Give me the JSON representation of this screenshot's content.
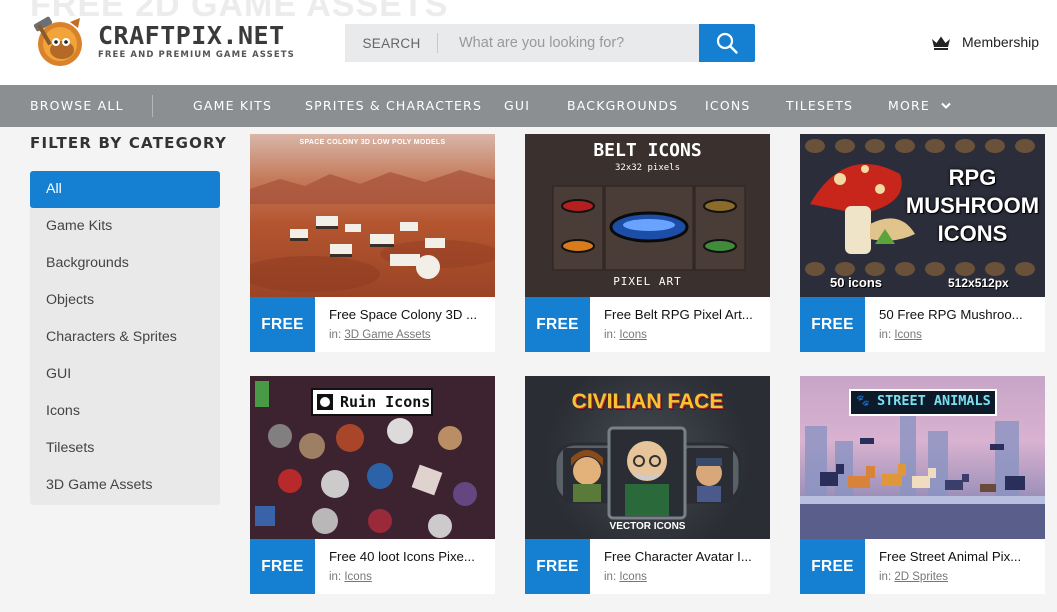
{
  "header": {
    "ghost_title": "FREE 2D GAME ASSETS",
    "logo_name": "CRAFTPIX.NET",
    "logo_tagline": "FREE AND PREMIUM GAME ASSETS",
    "search_label": "SEARCH",
    "search_placeholder": "What are you looking for?",
    "membership_label": "Membership"
  },
  "nav": {
    "browse_all": "BROWSE ALL",
    "items": [
      "GAME KITS",
      "SPRITES & CHARACTERS",
      "GUI",
      "BACKGROUNDS",
      "ICONS",
      "TILESETS",
      "MORE"
    ]
  },
  "sidebar": {
    "title": "FILTER BY CATEGORY",
    "items": [
      "All",
      "Game Kits",
      "Backgrounds",
      "Objects",
      "Characters & Sprites",
      "GUI",
      "Icons",
      "Tilesets",
      "3D Game Assets"
    ],
    "active_index": 0
  },
  "cards": [
    {
      "badge": "FREE",
      "title": "Free Space Colony 3D ...",
      "in_label": "in:",
      "category": "3D Game Assets",
      "thumb_title": "SPACE COLONY 3D LOW POLY MODELS"
    },
    {
      "badge": "FREE",
      "title": "Free Belt RPG Pixel Art...",
      "in_label": "in:",
      "category": "Icons",
      "thumb_title": "BELT ICONS",
      "thumb_sub": "32x32 pixels",
      "thumb_footer": "PIXEL ART"
    },
    {
      "badge": "FREE",
      "title": "50 Free RPG Mushroo...",
      "in_label": "in:",
      "category": "Icons",
      "thumb_title": "RPG MUSHROOM ICONS",
      "thumb_count": "50 icons",
      "thumb_size": "512x512px"
    },
    {
      "badge": "FREE",
      "title": "Free 40 loot Icons Pixe...",
      "in_label": "in:",
      "category": "Icons",
      "thumb_title": "Ruin Icons"
    },
    {
      "badge": "FREE",
      "title": "Free Character Avatar I...",
      "in_label": "in:",
      "category": "Icons",
      "thumb_title": "CIVILIAN FACE",
      "thumb_footer": "VECTOR ICONS"
    },
    {
      "badge": "FREE",
      "title": "Free Street Animal Pix...",
      "in_label": "in:",
      "category": "2D Sprites",
      "thumb_title": "STREET ANIMALS"
    }
  ],
  "colors": {
    "accent": "#1580d1",
    "nav_bg": "#8c8f92"
  }
}
